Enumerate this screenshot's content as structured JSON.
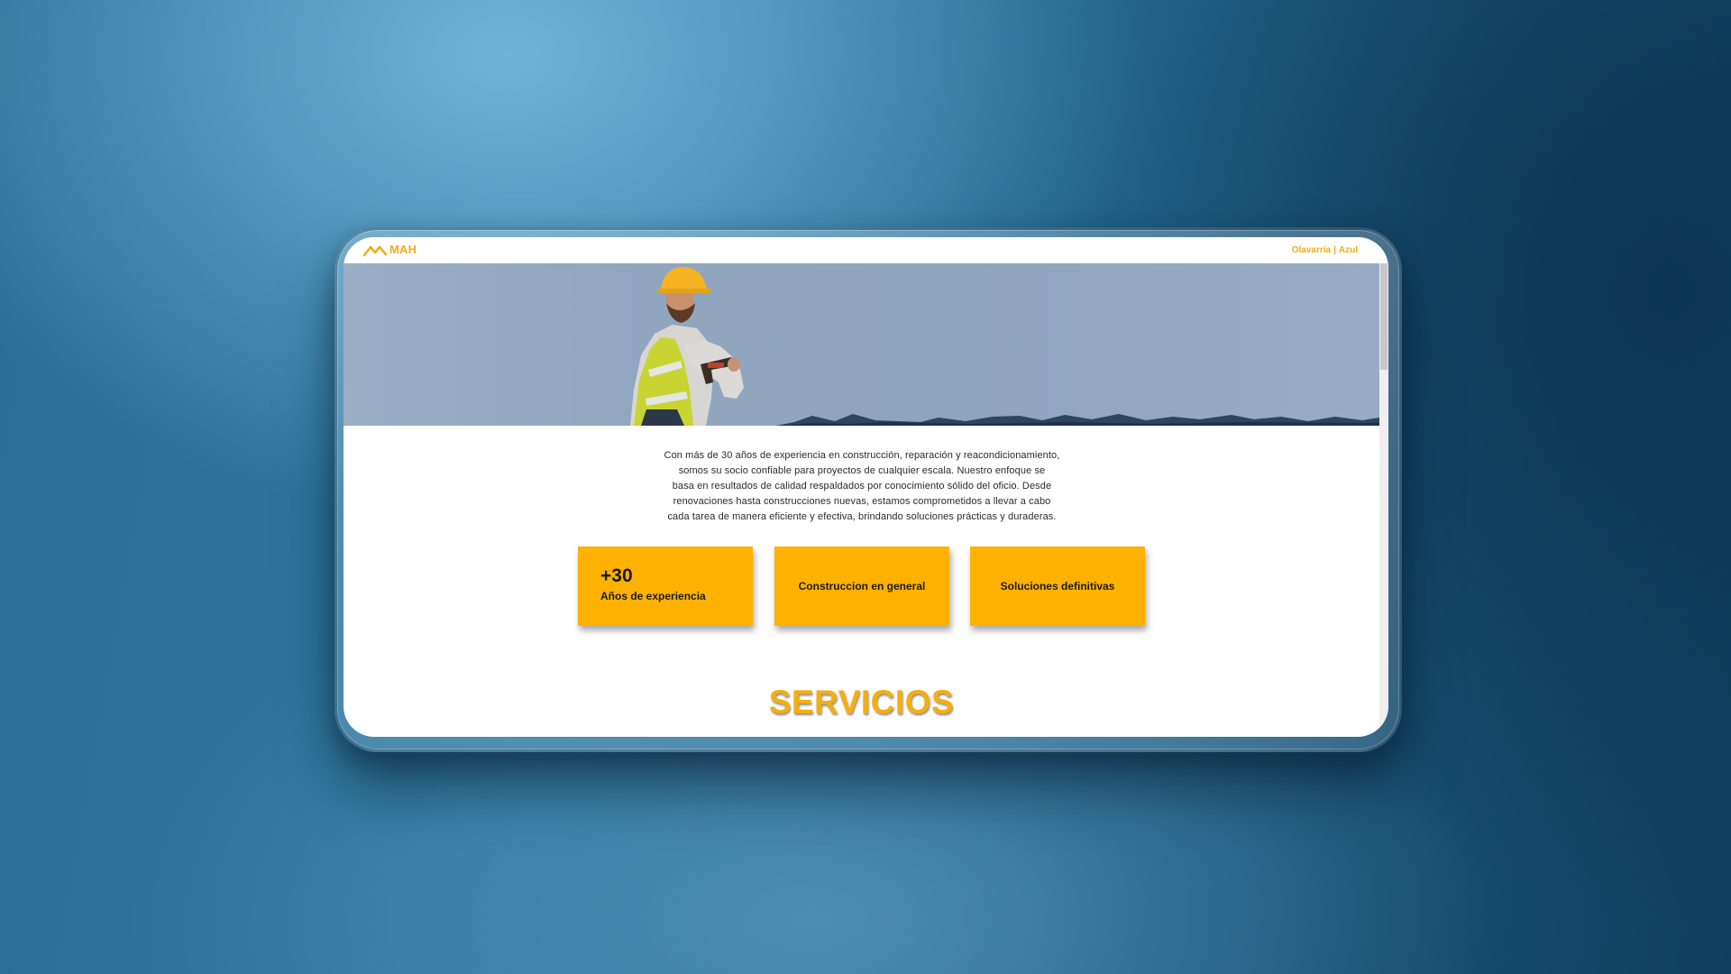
{
  "brand": {
    "logo_text": "MAH",
    "accent_color": "#ffb100",
    "text_accent_color": "#f2ac1a"
  },
  "nav": {
    "links": [
      "Olavarría",
      "Azul"
    ],
    "separator": "|"
  },
  "hero": {
    "image_description_icon": "construction-worker-photo"
  },
  "intro": {
    "lines": [
      "Con más de 30 años de experiencia en construcción, reparación y reacondicionamiento,",
      "somos su socio confiable para proyectos de cualquier escala. Nuestro enfoque se",
      "basa en resultados de calidad respaldados por conocimiento sólido del oficio. Desde",
      "renovaciones hasta construcciones nuevas, estamos comprometidos a llevar a cabo",
      "cada tarea de manera eficiente y efectiva, brindando soluciones prácticas y duraderas."
    ]
  },
  "cards": [
    {
      "big": "+30",
      "small": "Años de experiencia"
    },
    {
      "label": "Construccion en general"
    },
    {
      "label": "Soluciones definitivas"
    }
  ],
  "services": {
    "title": "SERVICIOS"
  }
}
